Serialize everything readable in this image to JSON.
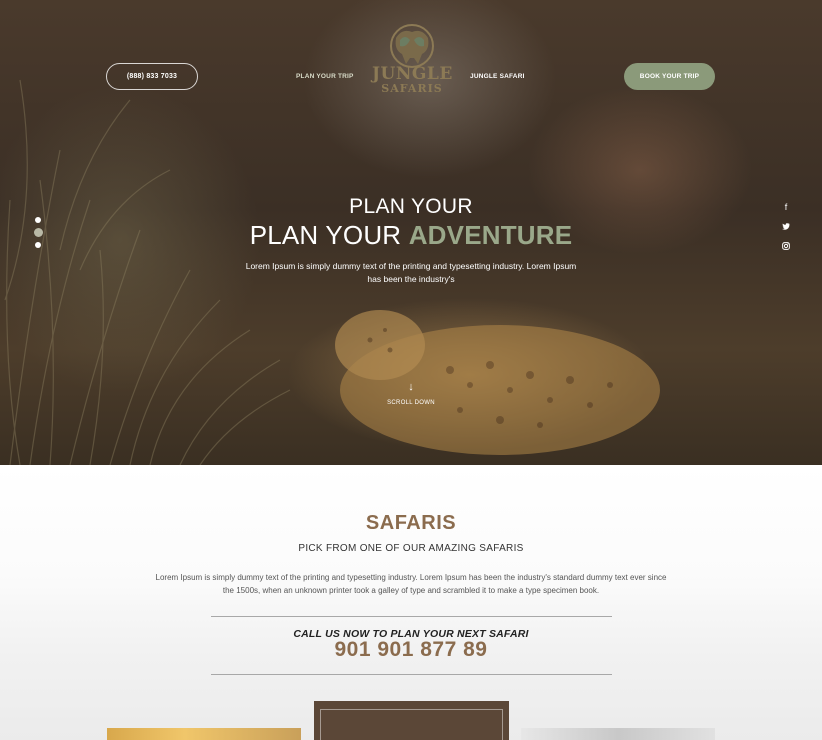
{
  "header": {
    "phone": "(888) 833 7033",
    "nav": [
      "PLAN YOUR TRIP",
      "JUNGLE SAFARI"
    ],
    "logo_line1": "JUNGLE",
    "logo_line2": "SAFARIS",
    "book_button": "BOOK YOUR TRIP"
  },
  "hero": {
    "subtitle": "PLAN YOUR",
    "title_plain": "PLAN YOUR ",
    "title_accent": "ADVENTURE",
    "description": "Lorem Ipsum is simply dummy text of the printing and typesetting industry. Lorem Ipsum has been the industry's",
    "scroll_label": "SCROLL DOWN",
    "slider_dots": 3,
    "active_dot": 2,
    "social_icons": [
      "facebook-icon",
      "twitter-icon",
      "instagram-icon"
    ]
  },
  "safaris": {
    "title": "SAFARIS",
    "subtitle": "PICK FROM ONE OF OUR AMAZING SAFARIS",
    "description": "Lorem Ipsum is simply dummy text of the printing and typesetting industry. Lorem Ipsum has been the industry's standard dummy text ever since the 1500s, when an unknown printer took a galley of type and scrambled it to make a type specimen book.",
    "call_label": "CALL US NOW TO PLAN YOUR NEXT SAFARI",
    "call_number": "901 901 877 89"
  },
  "colors": {
    "accent_green": "#8b9a7a",
    "brand_brown": "#8b6c4e"
  }
}
